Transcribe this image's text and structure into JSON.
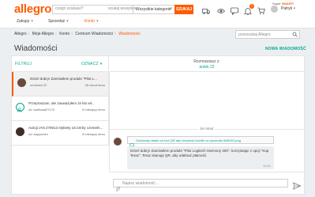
{
  "header": {
    "logo": "allegro",
    "search_placeholder": "czego szukasz?",
    "search_scope": "szukaj wszędzie",
    "category": "Wszystkie kategorie",
    "search_button": "SZUKAJ",
    "cart_badge": "1",
    "smart_label": "Super",
    "smart_brand": "SMART!",
    "user_name": "Patryk"
  },
  "nav": {
    "items": [
      "Zakupy",
      "Sprzedaż",
      "Konto"
    ]
  },
  "breadcrumb": {
    "items": [
      "Allegro",
      "Moje Allegro",
      "Konto",
      "Centrum Wiadomości",
      "Wiadomości"
    ]
  },
  "message_search_placeholder": "przeszukaj Allegro",
  "page": {
    "title": "Wiadomości",
    "new_message": "NOWA WIADOMOŚĆ"
  },
  "list": {
    "filter": "FILTRUJ",
    "mark": "OZNACZ",
    "threads": [
      {
        "subject": "Dzień dobry! Zamówiłem produkt \"Pilot L...",
        "from": "od Antek 22",
        "time": "26 minut temu"
      },
      {
        "subject": "Przepraszam, ale zauważyłem że kto wł...",
        "from": "od: karibaral27170",
        "time": "5 miesięcy temu"
      },
      {
        "subject": "Aukcji IAN 276913 etykiety szczerby czemeln...",
        "from": "od: kayyumen",
        "time": "5 miesięcy temu"
      }
    ]
  },
  "conversation": {
    "with_label": "Rozmawiasz z:",
    "with_name": "antek 22",
    "date": "16 minut",
    "attachment": "Zachowaj rabatu za kod QR aby otrzymać kuzdle za sprzedaż AN8091.png",
    "message": "Dzień dobry! Zamówiłem produkt \"Pilot Logitech Harmony 300\", korzystając z opcji \"Kup Teraz\". Teraz skanuję QR, aby odebrać płatność.",
    "message_time": "12:01",
    "compose_placeholder": "Napisz wiadomość..."
  },
  "colors": {
    "accent": "#ff5a00",
    "link": "#00a790"
  }
}
